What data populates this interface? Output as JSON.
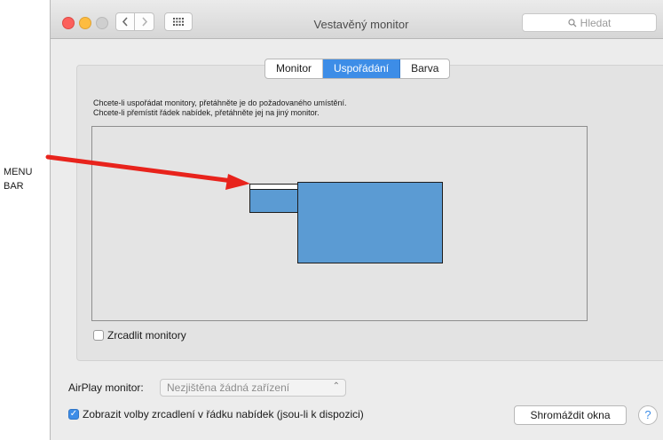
{
  "annotation": {
    "label_line1": "MENU",
    "label_line2": "BAR"
  },
  "window": {
    "title": "Vestavěný monitor",
    "search_placeholder": "Hledat",
    "icons": {
      "back": "chevron-left-icon",
      "forward": "chevron-right-icon",
      "grid": "grid-icon",
      "search": "search-icon"
    }
  },
  "tabs": [
    {
      "label": "Monitor",
      "active": false
    },
    {
      "label": "Uspořádání",
      "active": true
    },
    {
      "label": "Barva",
      "active": false
    }
  ],
  "arrangement": {
    "instruction_line1": "Chcete-li uspořádat monitory, přetáhněte je do požadovaného umístění.",
    "instruction_line2": "Chcete-li přemístit řádek nabídek, přetáhněte jej na jiný monitor."
  },
  "mirror": {
    "label": "Zrcadlit monitory",
    "checked": false
  },
  "airplay": {
    "label": "AirPlay monitor:",
    "value": "Nezjištěna žádná zařízení"
  },
  "show_options": {
    "label": "Zobrazit volby zrcadlení v řádku nabídek (jsou-li k dispozici)",
    "checked": true
  },
  "buttons": {
    "gather": "Shromáždit okna",
    "help": "?"
  },
  "colors": {
    "accent": "#3d8de7",
    "monitor_fill": "#5b9bd3",
    "arrow": "#e8231c"
  }
}
